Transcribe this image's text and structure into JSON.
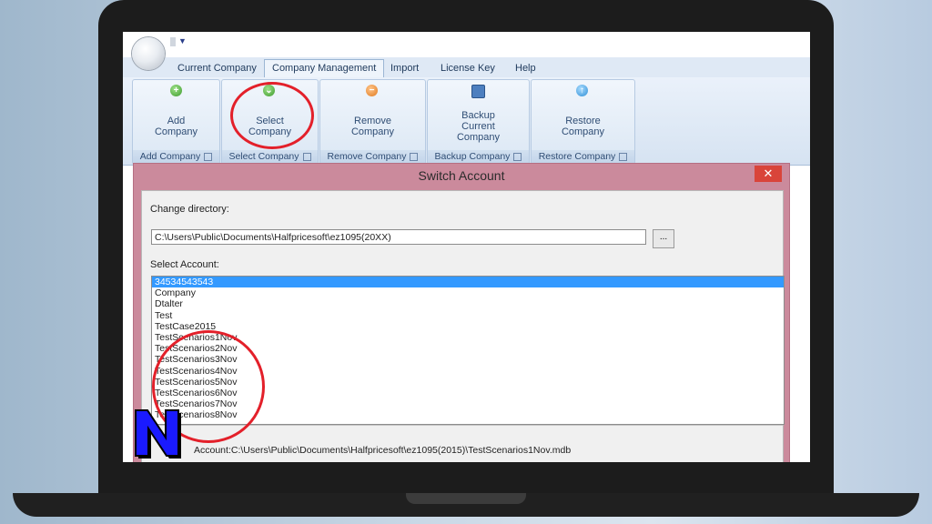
{
  "ribbon": {
    "tabs": [
      "Current Company",
      "Company Management",
      "Import",
      "License Key",
      "Help"
    ],
    "active_tab": "Company Management",
    "groups": [
      {
        "button": "Add\nCompany",
        "label": "Add Company",
        "icon": "add-icon"
      },
      {
        "button": "Select\nCompany",
        "label": "Select Company",
        "icon": "select-icon"
      },
      {
        "button": "Remove\nCompany",
        "label": "Remove Company",
        "icon": "remove-icon"
      },
      {
        "button": "Backup\nCurrent\nCompany",
        "label": "Backup Company",
        "icon": "save-icon"
      },
      {
        "button": "Restore\nCompany",
        "label": "Restore Company",
        "icon": "restore-icon"
      }
    ]
  },
  "dialog": {
    "title": "Switch Account",
    "close": "✕",
    "change_directory_label": "Change directory:",
    "directory_value": "C:\\Users\\Public\\Documents\\Halfpricesoft\\ez1095(20XX)",
    "browse_label": "...",
    "select_account_label": "Select Account:",
    "accounts": [
      "34534543543",
      "Company",
      "Dtalter",
      "Test",
      "TestCase2015",
      "TestScenarios1Nov",
      "TestScenarios2Nov",
      "TestScenarios3Nov",
      "TestScenarios4Nov",
      "TestScenarios5Nov",
      "TestScenarios6Nov",
      "TestScenarios7Nov",
      "TestScenarios8Nov"
    ],
    "selected_index": 0,
    "status_text": "Account:C:\\Users\\Public\\Documents\\Halfpricesoft\\ez1095(2015)\\TestScenarios1Nov.mdb"
  },
  "logo": {
    "letter": "N",
    "fill": "#1a1aff",
    "stroke": "#000000"
  },
  "colors": {
    "highlight_circle": "#e3202a",
    "dialog_frame": "#cb8a9c",
    "selection": "#3399ff"
  }
}
